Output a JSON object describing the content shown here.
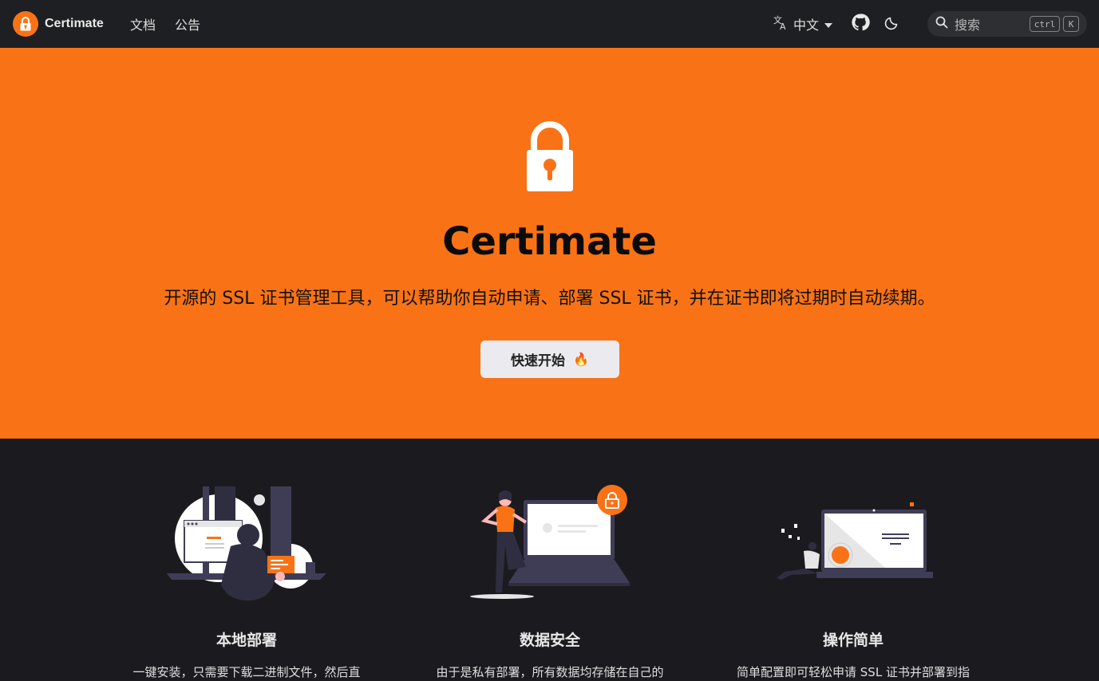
{
  "nav": {
    "brand": "Certimate",
    "links": [
      "文档",
      "公告"
    ],
    "language": "中文",
    "search_placeholder": "搜索",
    "kbd_ctrl": "ctrl",
    "kbd_k": "K"
  },
  "hero": {
    "title": "Certimate",
    "description": "开源的 SSL 证书管理工具，可以帮助你自动申请、部署 SSL 证书，并在证书即将过期时自动续期。",
    "cta_label": "快速开始",
    "cta_emoji": "🔥"
  },
  "features": [
    {
      "title": "本地部署",
      "desc": "一键安装，只需要下载二进制文件，然后直"
    },
    {
      "title": "数据安全",
      "desc": "由于是私有部署，所有数据均存储在自己的"
    },
    {
      "title": "操作简单",
      "desc": "简单配置即可轻松申请 SSL 证书并部署到指"
    }
  ],
  "colors": {
    "accent": "#f97316",
    "navbar_bg": "#1e1f22",
    "page_bg": "#1b1b1f",
    "cta_bg": "#ebebef"
  },
  "icons": [
    "lock-icon",
    "translate-icon",
    "chevron-down-icon",
    "github-icon",
    "moon-icon",
    "search-icon",
    "fire-icon"
  ]
}
